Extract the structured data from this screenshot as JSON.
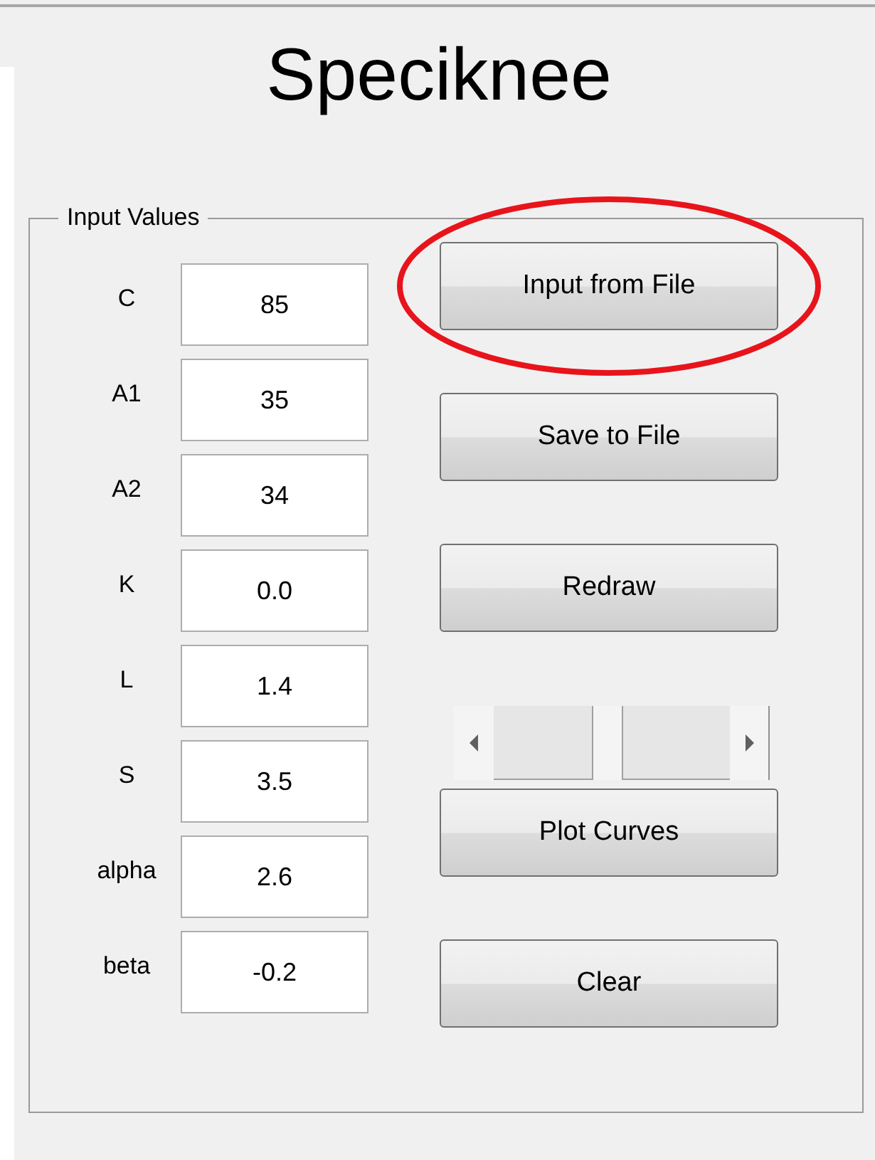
{
  "title": "Speciknee",
  "panel": {
    "title": "Input Values",
    "fields": [
      {
        "label": "C",
        "value": "85"
      },
      {
        "label": "A1",
        "value": "35"
      },
      {
        "label": "A2",
        "value": "34"
      },
      {
        "label": "K",
        "value": "0.0"
      },
      {
        "label": "L",
        "value": "1.4"
      },
      {
        "label": "S",
        "value": "3.5"
      },
      {
        "label": "alpha",
        "value": "2.6"
      },
      {
        "label": "beta",
        "value": "-0.2"
      }
    ],
    "controls": [
      {
        "kind": "button",
        "label": "Input from File",
        "highlighted": true
      },
      {
        "kind": "button",
        "label": "Save to File",
        "highlighted": false
      },
      {
        "kind": "button",
        "label": "Redraw",
        "highlighted": false
      },
      {
        "kind": "slider",
        "level": 0.48
      },
      {
        "kind": "button",
        "label": "Plot Curves",
        "highlighted": false
      },
      {
        "kind": "button",
        "label": "Clear",
        "highlighted": false
      }
    ]
  }
}
